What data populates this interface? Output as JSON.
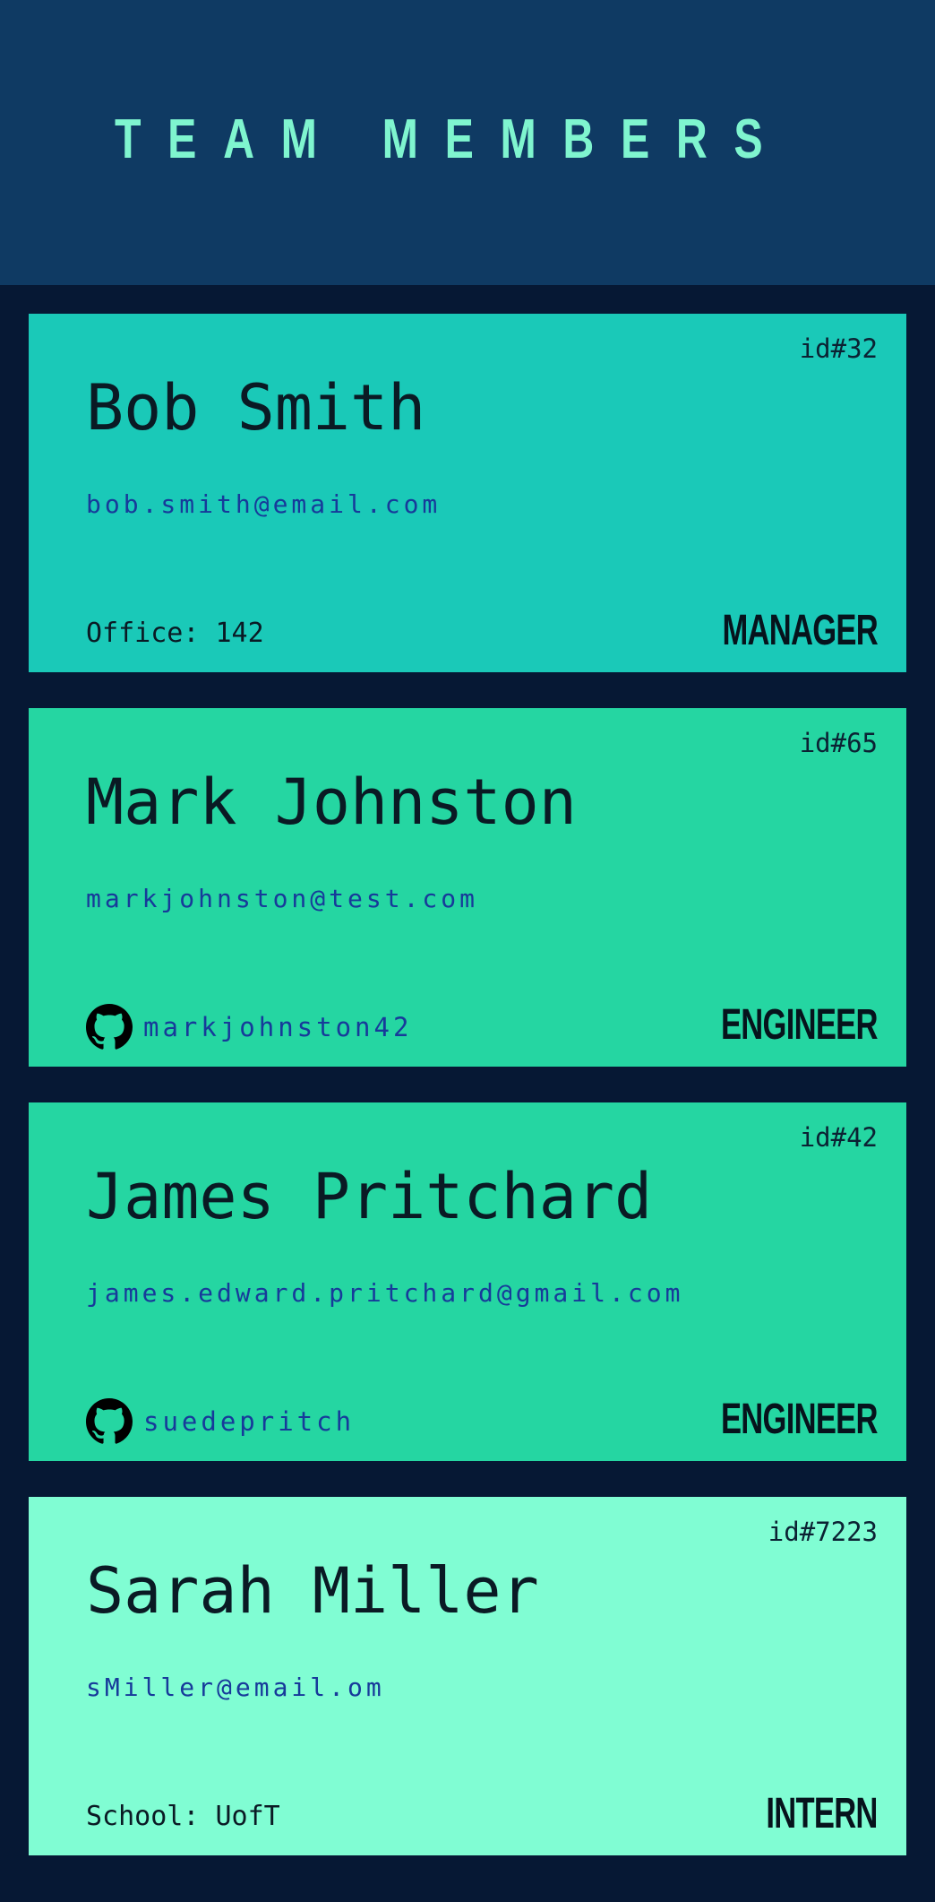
{
  "header": {
    "title": "TEAM MEMBERS",
    "background": "#0f3a63",
    "title_color": "#7ff5cf"
  },
  "page": {
    "background": "#061834"
  },
  "members": [
    {
      "id": "id#32",
      "name": "Bob Smith",
      "email": "bob.smith@email.com",
      "extra_type": "office",
      "extra": "Office: 142",
      "role": "MANAGER",
      "color": "#1ac9b8"
    },
    {
      "id": "id#65",
      "name": "Mark Johnston",
      "email": "markjohnston@test.com",
      "extra_type": "github",
      "extra": "markjohnston42",
      "icon": "github-icon",
      "role": "ENGINEER",
      "color": "#25d6a2"
    },
    {
      "id": "id#42",
      "name": "James Pritchard",
      "email": "james.edward.pritchard@gmail.com",
      "extra_type": "github",
      "extra": "suedepritch",
      "icon": "github-icon",
      "role": "ENGINEER",
      "color": "#25d6a2"
    },
    {
      "id": "id#7223",
      "name": "Sarah Miller",
      "email": "sMiller@email.om",
      "extra_type": "school",
      "extra": "School: UofT",
      "role": "INTERN",
      "color": "#80fdd3"
    }
  ]
}
